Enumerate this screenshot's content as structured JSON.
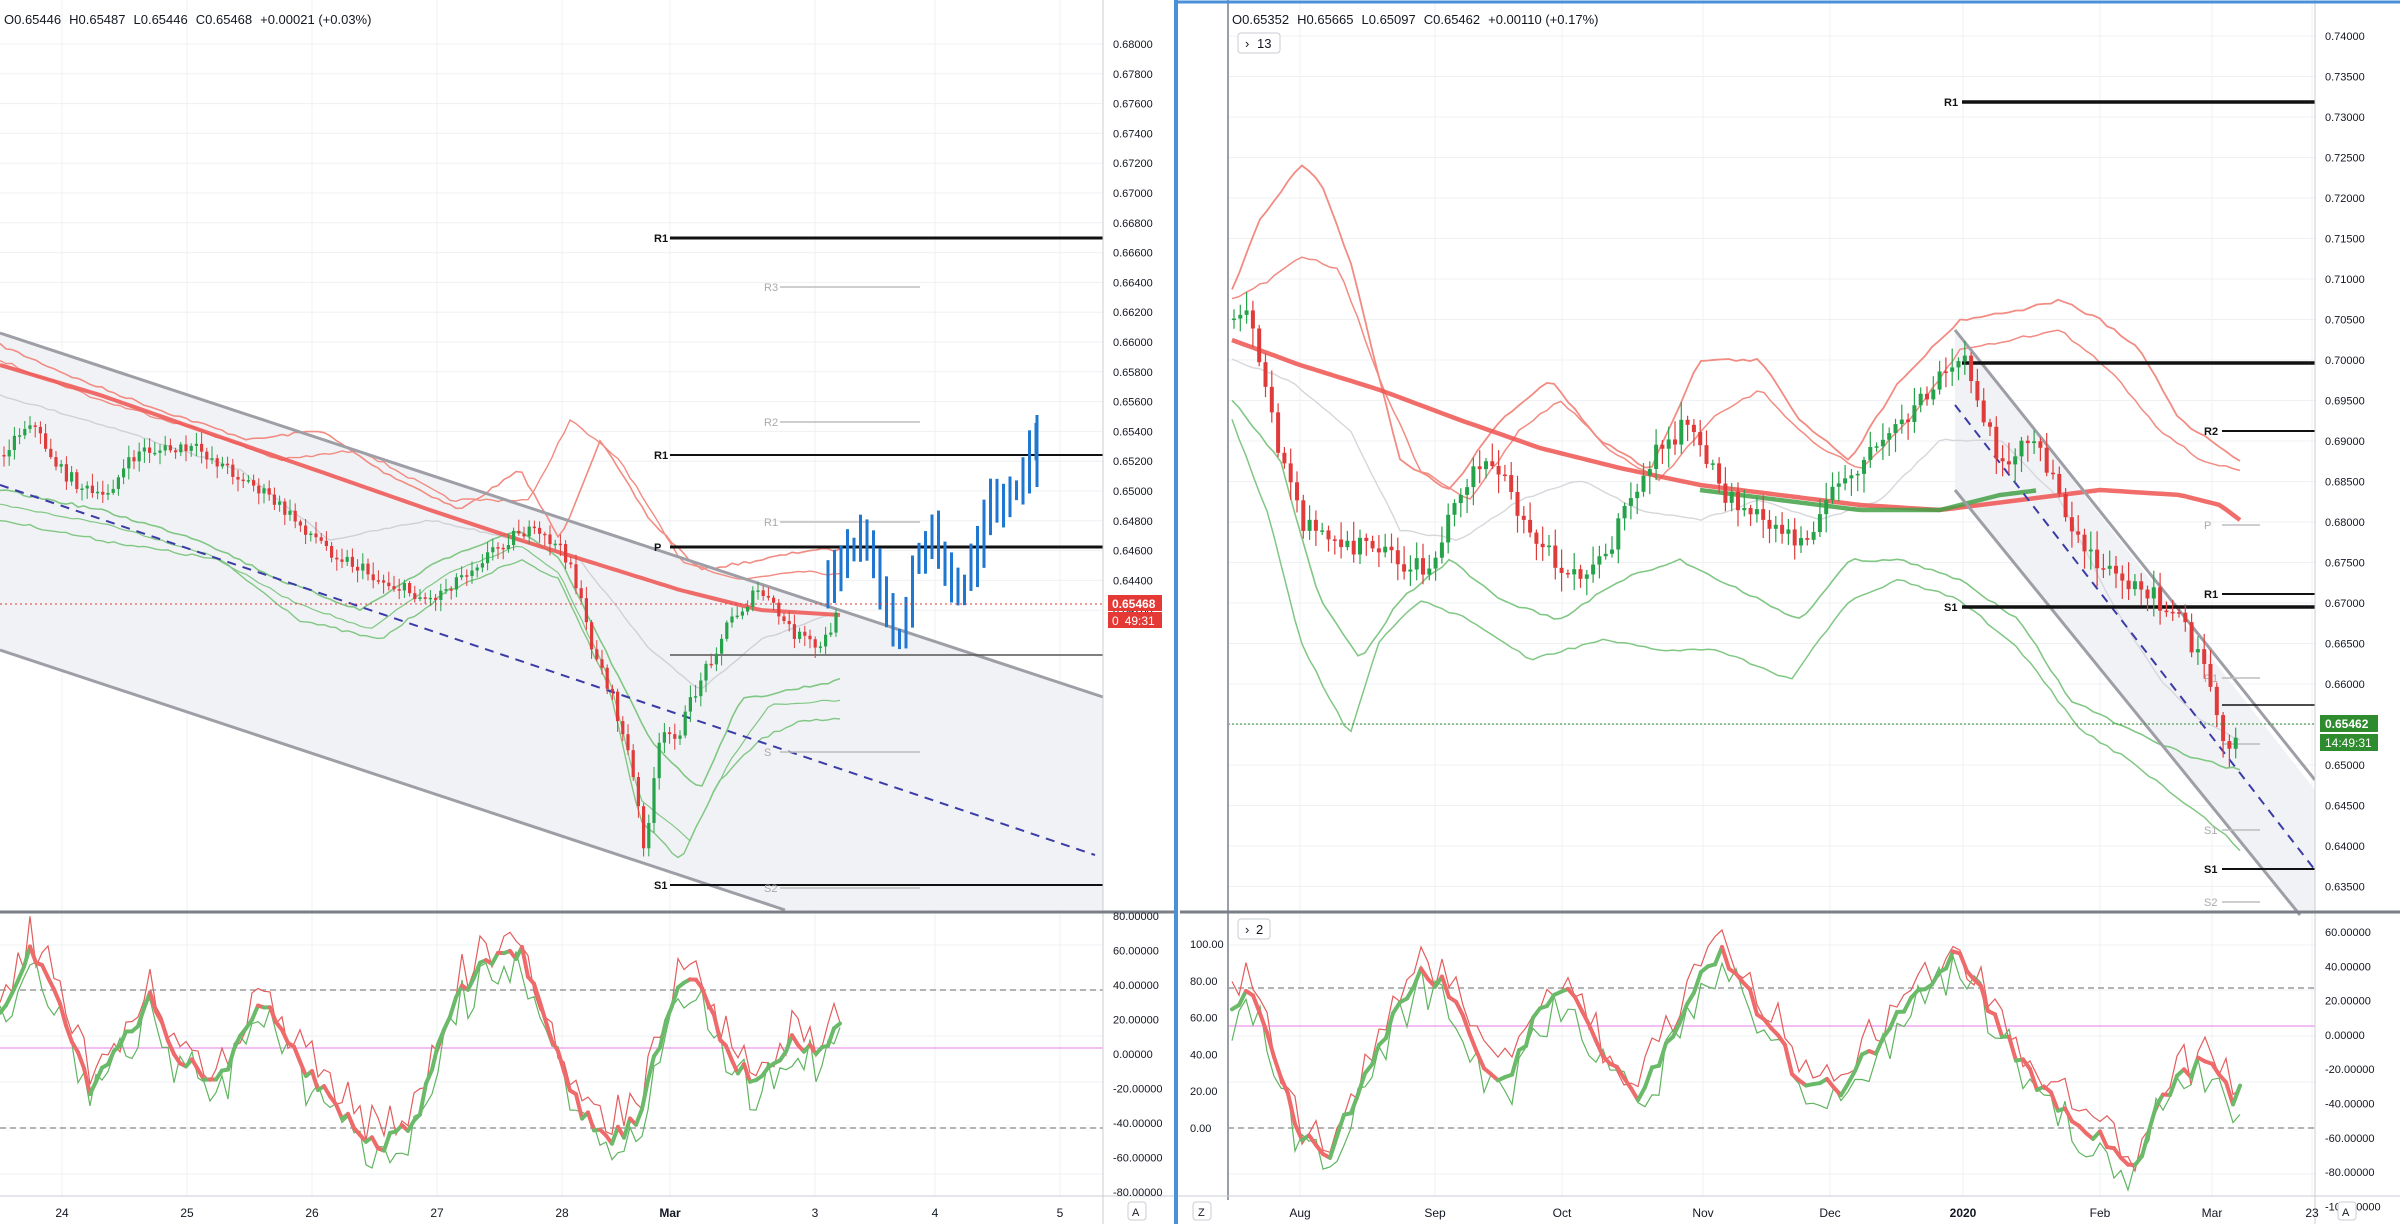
{
  "left": {
    "ohlc": {
      "o": "O0.65446",
      "h": "H0.65487",
      "l": "L0.65446",
      "c": "C0.65468",
      "chg": "+0.00021 (+0.03%)"
    },
    "price_badge": {
      "value": "0.65468",
      "timer": "49:31",
      "value_prefix": "0"
    },
    "price_axis": [
      "0.68000",
      "0.67800",
      "0.67600",
      "0.67400",
      "0.67200",
      "0.67000",
      "0.66800",
      "0.66600",
      "0.66400",
      "0.66200",
      "0.66000",
      "0.65800",
      "0.65600",
      "0.65400",
      "0.65200",
      "0.65000",
      "0.64800",
      "0.64600",
      "0.64400",
      "0.64200"
    ],
    "osc_axis": [
      "80.00000",
      "60.00000",
      "40.00000",
      "20.00000",
      "0.00000",
      "-20.00000",
      "-40.00000",
      "-60.00000",
      "-80.00000"
    ],
    "time_axis": [
      "24",
      "25",
      "26",
      "27",
      "28",
      "Mar",
      "3",
      "4",
      "5"
    ],
    "pivot_labels": {
      "R1_top": "R1",
      "R3": "R3",
      "R2": "R2",
      "R1_mid": "R1",
      "P": "P",
      "R1_small": "R1",
      "S_small": "S",
      "S1": "S1",
      "S2": "S2"
    },
    "auto_scale": "A"
  },
  "right": {
    "ohlc": {
      "o": "O0.65352",
      "h": "H0.65665",
      "l": "L0.65097",
      "c": "C0.65462",
      "chg": "+0.00110 (+0.17%)"
    },
    "indicator_toggle": "13",
    "osc_toggle": "2",
    "price_badge": {
      "value": "0.65462",
      "timer": "14:49:31"
    },
    "price_axis": [
      "0.74000",
      "0.73500",
      "0.73000",
      "0.72500",
      "0.72000",
      "0.71500",
      "0.71000",
      "0.70500",
      "0.70000",
      "0.69500",
      "0.69000",
      "0.68500",
      "0.68000",
      "0.67500",
      "0.67000",
      "0.66500",
      "0.66000",
      "0.65500",
      "0.65000",
      "0.64500",
      "0.64000",
      "0.63500"
    ],
    "osc_axis": [
      "60.00000",
      "40.00000",
      "20.00000",
      "0.00000",
      "-20.00000",
      "-40.00000",
      "-60.00000",
      "-80.00000",
      "-100.00000"
    ],
    "osc_left_axis": [
      "100.00",
      "80.00",
      "60.00",
      "40.00",
      "20.00",
      "0.00"
    ],
    "time_axis": [
      "Aug",
      "Sep",
      "Oct",
      "Nov",
      "Dec",
      "2020",
      "Feb",
      "Mar",
      "23"
    ],
    "pivot_labels": {
      "R1_top": "R1",
      "R2": "R2",
      "R1": "R1",
      "S1": "S1",
      "R1_small": "R1",
      "S_small": "S1",
      "S1_low": "S1",
      "S2": "S2",
      "P_small": "P"
    },
    "z_button": "Z",
    "auto_scale": "A"
  },
  "colors": {
    "bull": "#26a34a",
    "bear": "#e03b3b",
    "blue": "#1f77d0",
    "ma": "#ef5350",
    "ma_green": "#43a047",
    "band_red": "#f28b82",
    "band_green": "#81c784",
    "channel": "#9e9ea6",
    "dashed": "#3b3ba8",
    "pivot": "#111111",
    "grid": "#eef0f3",
    "badge_red": "#e53935",
    "badge_green": "#2e8b2e",
    "divider": "#4a90d9"
  }
}
